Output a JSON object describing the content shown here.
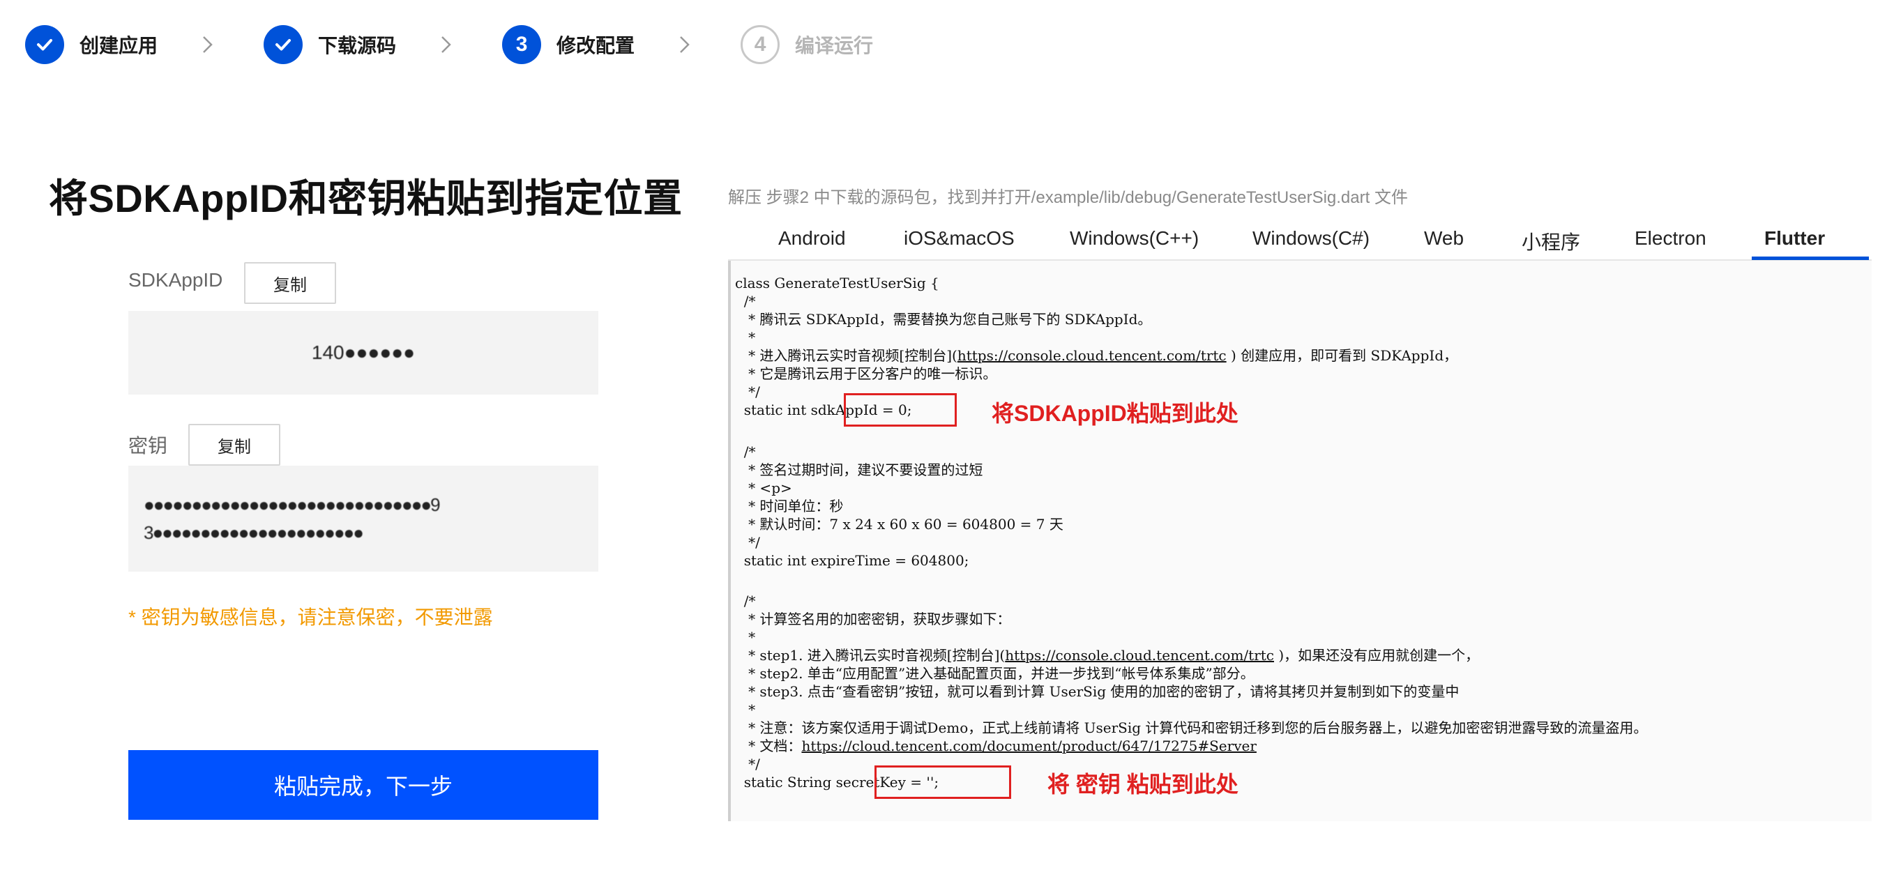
{
  "steps": [
    {
      "num": "1",
      "label": "创建应用",
      "state": "done"
    },
    {
      "num": "2",
      "label": "下载源码",
      "state": "done"
    },
    {
      "num": "3",
      "label": "修改配置",
      "state": "active"
    },
    {
      "num": "4",
      "label": "编译运行",
      "state": "pending"
    }
  ],
  "left": {
    "title": "将SDKAppID和密钥粘贴到指定位置",
    "sdkappid_label": "SDKAppID",
    "copy_label": "复制",
    "sdkappid_value": "140●●●●●●",
    "secret_label": "密钥",
    "secret_line1": "●●●●●●●●●●●●●●●●●●●●●●●●●●●●●●9",
    "secret_line2": "3●●●●●●●●●●●●●●●●●●●●●●",
    "warning": "* 密钥为敏感信息，请注意保密，不要泄露",
    "next_label": "粘贴完成，下一步"
  },
  "right": {
    "hint": "解压 步骤2 中下载的源码包，找到并打开/example/lib/debug/GenerateTestUserSig.dart 文件",
    "tabs": [
      "Android",
      "iOS&macOS",
      "Windows(C++)",
      "Windows(C#)",
      "Web",
      "小程序",
      "Electron",
      "Flutter"
    ],
    "active_tab": "Flutter",
    "code": {
      "l1": "class GenerateTestUserSig {",
      "l2": "  /*",
      "l3": "   * 腾讯云 SDKAppId，需要替换为您自己账号下的 SDKAppId。",
      "l4": "   *",
      "l5a": "   * 进入腾讯云实时音视频[控制台](",
      "l5link": "https://console.cloud.tencent.com/trtc",
      "l5b": " ) 创建应用，即可看到 SDKAppId，",
      "l6": "   * 它是腾讯云用于区分客户的唯一标识。",
      "l7": "   */",
      "l8": "  static int sdkAppId = 0;",
      "l9": "  /*",
      "l10": "   * 签名过期时间，建议不要设置的过短",
      "l11": "   * <p>",
      "l12": "   * 时间单位：秒",
      "l13": "   * 默认时间：7 x 24 x 60 x 60 = 604800 = 7 天",
      "l14": "   */",
      "l15": "  static int expireTime = 604800;",
      "l16": "  /*",
      "l17": "   * 计算签名用的加密密钥，获取步骤如下：",
      "l18": "   *",
      "l19a": "   * step1. 进入腾讯云实时音视频[控制台](",
      "l19link": "https://console.cloud.tencent.com/trtc",
      "l19b": " )，如果还没有应用就创建一个，",
      "l20": "   * step2. 单击“应用配置”进入基础配置页面，并进一步找到“帐号体系集成”部分。",
      "l21": "   * step3. 点击“查看密钥”按钮，就可以看到计算 UserSig 使用的加密的密钥了，请将其拷贝并复制到如下的变量中",
      "l22": "   *",
      "l23": "   * 注意：该方案仅适用于调试Demo，正式上线前请将 UserSig 计算代码和密钥迁移到您的后台服务器上，以避免加密密钥泄露导致的流量盗用。",
      "l24a": "   * 文档：",
      "l24link": "https://cloud.tencent.com/document/product/647/17275#Server",
      "l25": "   */",
      "l26": "  static String secretKey = '';"
    },
    "annotation1": "将SDKAppID粘贴到此处",
    "annotation2": "将 密钥 粘贴到此处",
    "annotation_color": "#e02020"
  }
}
